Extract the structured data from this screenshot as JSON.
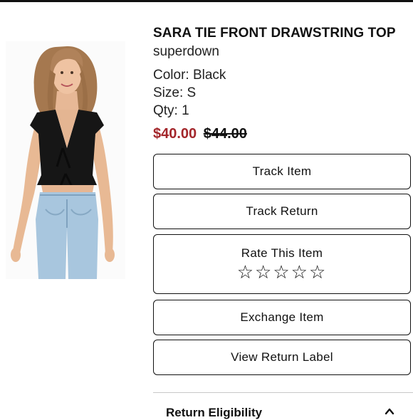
{
  "product": {
    "title": "SARA TIE FRONT DRAWSTRING TOP",
    "brand": "superdown",
    "color": "Color: Black",
    "size": "Size: S",
    "qty": "Qty: 1",
    "sale_price": "$40.00",
    "original_price": "$44.00"
  },
  "actions": {
    "track_item": "Track Item",
    "track_return": "Track Return",
    "rate_item": "Rate This Item",
    "rating_stars": "☆☆☆☆☆",
    "exchange_item": "Exchange Item",
    "view_return_label": "View Return Label"
  },
  "section": {
    "return_eligibility": "Return Eligibility"
  },
  "icons": {
    "expand": "chevron-up-icon"
  },
  "colors": {
    "sale_price": "#a3262b",
    "text": "#111111"
  }
}
